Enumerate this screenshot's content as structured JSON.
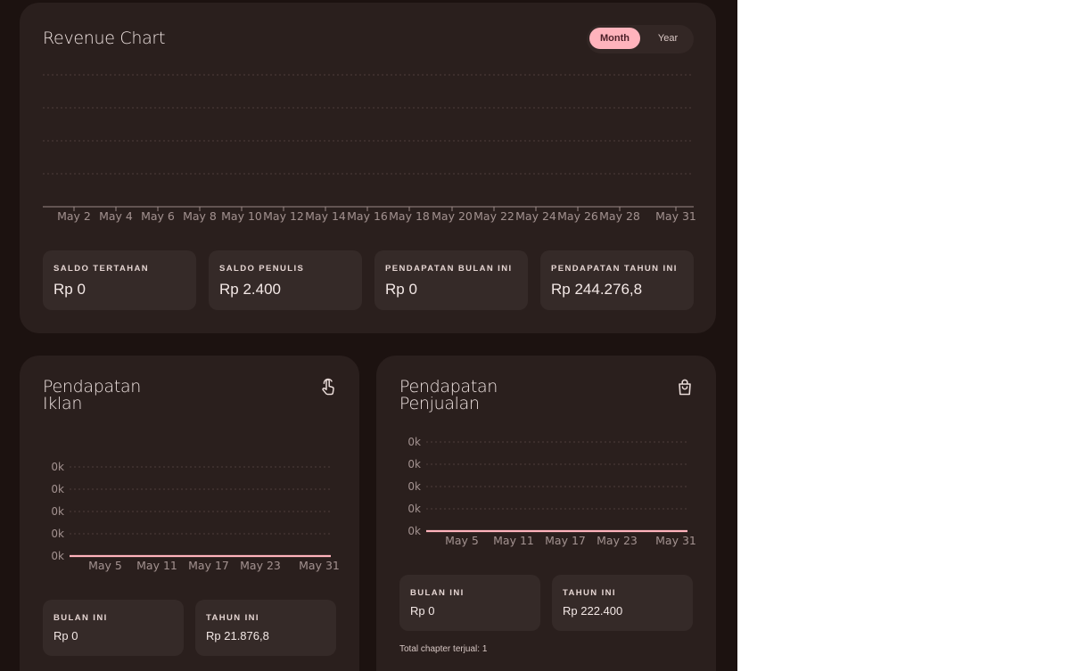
{
  "revenue": {
    "title": "Revenue Chart",
    "toggle": {
      "month": "Month",
      "year": "Year",
      "active": "month"
    },
    "stats": [
      {
        "label": "SALDO TERTAHAN",
        "value": "Rp 0"
      },
      {
        "label": "SALDO PENULIS",
        "value": "Rp 2.400"
      },
      {
        "label": "PENDAPATAN BULAN INI",
        "value": "Rp 0"
      },
      {
        "label": "PENDAPATAN TAHUN INI",
        "value": "Rp 244.276,8"
      }
    ]
  },
  "ads": {
    "title": "Pendapatan\nIklan",
    "icon": "touch-icon",
    "stats": [
      {
        "label": "BULAN INI",
        "value": "Rp 0"
      },
      {
        "label": "TAHUN INI",
        "value": "Rp 21.876,8"
      }
    ]
  },
  "sales": {
    "title": "Pendapatan\nPenjualan",
    "icon": "shopping-bag-icon",
    "stats": [
      {
        "label": "BULAN INI",
        "value": "Rp 0"
      },
      {
        "label": "TAHUN INI",
        "value": "Rp 222.400"
      }
    ],
    "footer": "Total chapter terjual: 1"
  },
  "colors": {
    "line": "#ffb3bc",
    "grid": "#5a4a47",
    "axis": "#9a8a87"
  },
  "chart_data": [
    {
      "id": "revenue",
      "type": "line",
      "categories": [
        "May 2",
        "May 4",
        "May 6",
        "May 8",
        "May 10",
        "May 12",
        "May 14",
        "May 16",
        "May 18",
        "May 20",
        "May 22",
        "May 24",
        "May 26",
        "May 28",
        "May 31"
      ],
      "series": [
        {
          "values": []
        }
      ],
      "grid": true
    },
    {
      "id": "ads",
      "type": "line",
      "categories": [
        "May 5",
        "May 11",
        "May 17",
        "May 23",
        "May 31"
      ],
      "y_ticks": [
        "0k",
        "0k",
        "0k",
        "0k",
        "0k"
      ],
      "series": [
        {
          "values": [
            0,
            0,
            0,
            0,
            0
          ]
        }
      ],
      "grid": true
    },
    {
      "id": "sales",
      "type": "line",
      "categories": [
        "May 5",
        "May 11",
        "May 17",
        "May 23",
        "May 31"
      ],
      "y_ticks": [
        "0k",
        "0k",
        "0k",
        "0k",
        "0k"
      ],
      "series": [
        {
          "values": [
            0,
            0,
            0,
            0,
            0
          ]
        }
      ],
      "grid": true
    }
  ]
}
